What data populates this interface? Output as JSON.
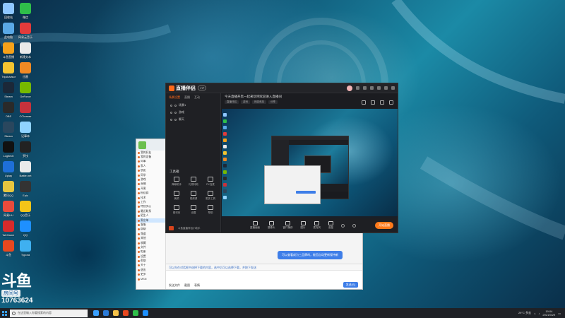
{
  "desktop_icons": [
    {
      "label": "回收站",
      "color": "#8ec7ff"
    },
    {
      "label": "微信",
      "color": "#2fbf4a"
    },
    {
      "label": "此电脑",
      "color": "#5aa9e6"
    },
    {
      "label": "网易云音乐",
      "color": "#e23b3b"
    },
    {
      "label": "斗鱼直播",
      "color": "#f6a21a"
    },
    {
      "label": "新建文本",
      "color": "#e9e9e9"
    },
    {
      "label": "TripAdvisor",
      "color": "#f4c430"
    },
    {
      "label": "迅雷",
      "color": "#f08a24"
    },
    {
      "label": "Steam",
      "color": "#1b2838"
    },
    {
      "label": "GeForce",
      "color": "#76b900"
    },
    {
      "label": "OBS",
      "color": "#2a2a2a"
    },
    {
      "label": "CCleaner",
      "color": "#c8323c"
    },
    {
      "label": "Steam",
      "color": "#2a475e"
    },
    {
      "label": "记事本",
      "color": "#8fd3ff"
    },
    {
      "label": "Logitech",
      "color": "#111111"
    },
    {
      "label": "罗技",
      "color": "#222222"
    },
    {
      "label": "Uplay",
      "color": "#1e6fd8"
    },
    {
      "label": "Battle.net",
      "color": "#eaeaea"
    },
    {
      "label": "腾讯QQ",
      "color": "#e6c63f"
    },
    {
      "label": "Epic",
      "color": "#333333"
    },
    {
      "label": "网易UU",
      "color": "#e94b3c"
    },
    {
      "label": "QQ音乐",
      "color": "#f5c518"
    },
    {
      "label": "WeGame",
      "color": "#d92b2b"
    },
    {
      "label": "QQ",
      "color": "#1e90ff"
    },
    {
      "label": "斗鱼",
      "color": "#e8481f"
    },
    {
      "label": "Typora",
      "color": "#3fb0f0"
    }
  ],
  "watermark": {
    "logo": "斗鱼",
    "room_label": "房间号",
    "room_number": "10763624"
  },
  "chat": {
    "bubble": "可以查看成为三品牌吗，能否自动更新保持新",
    "input_hint": "可以先在对话框中选择下载的内容，选中后可以选择下载，并按下发送",
    "tools": [
      "发送文件",
      "截图",
      "表情"
    ],
    "send": "发送(S)",
    "contacts": [
      "我的好友",
      "我的设备",
      "同事",
      "家人",
      "朋友",
      "同学",
      "游戏",
      "直播",
      "开黑",
      "粉丝群",
      "技术",
      "工作",
      "特别关心",
      "最近联系",
      "陌生人",
      "黑名单",
      "客服",
      "群聊",
      "频道",
      "其他",
      "收藏",
      "文件",
      "相册",
      "设置",
      "帮助",
      "关于",
      "退出",
      "更多",
      "MSN"
    ]
  },
  "app": {
    "title": "直播伴侣",
    "badge": "VIP",
    "left_tabs": [
      "场景设置",
      "直播",
      "互动"
    ],
    "scenes": [
      "场景1",
      "游戏",
      "聊天"
    ],
    "tools_label": "工具箱",
    "tools": [
      "弹幕助手",
      "礼物特效",
      "PK连麦",
      "美颜",
      "视频源",
      "更多工具",
      "素材库",
      "设置",
      "帮助"
    ],
    "footer_text": "斗鱼直播伴侣小助手",
    "stream_title": "今天直播开黑一起来玩吧欢迎进入直播间",
    "stream_tags": [
      "直播伴侣",
      "游戏",
      "网游竞技",
      "分享"
    ],
    "bottom_buttons": [
      "直播画面",
      "摄像头",
      "窗口捕获",
      "图片",
      "麦克风",
      "音量"
    ],
    "go_live": "开始直播"
  },
  "taskbar": {
    "search_placeholder": "在这里输入你要搜索的内容",
    "weather": "29°C 多云",
    "time": "19:04",
    "date": "2021/9/29"
  }
}
